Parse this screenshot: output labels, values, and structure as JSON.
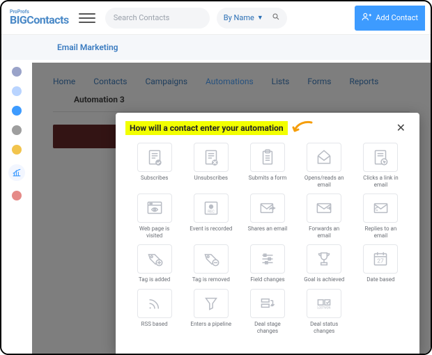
{
  "header": {
    "logo_top": "ProProfs",
    "logo_main": "BIGContacts",
    "search_placeholder": "Search Contacts",
    "filter_label": "By Name",
    "add_button": "Add Contact"
  },
  "subheader": {
    "title": "Email Marketing"
  },
  "tabs": [
    {
      "label": "Home"
    },
    {
      "label": "Contacts"
    },
    {
      "label": "Campaigns"
    },
    {
      "label": "Automations",
      "active": true
    },
    {
      "label": "Lists"
    },
    {
      "label": "Forms"
    },
    {
      "label": "Reports"
    }
  ],
  "automation": {
    "name": "Automation 3"
  },
  "modal": {
    "title": "How will a contact enter your automation",
    "triggers": [
      {
        "id": "subscribes",
        "label": "Subscribes",
        "icon": "doc-check"
      },
      {
        "id": "unsubscribes",
        "label": "Unsubscribes",
        "icon": "doc-x"
      },
      {
        "id": "submits-form",
        "label": "Submits a form",
        "icon": "clipboard"
      },
      {
        "id": "opens-email",
        "label": "Opens/reads an email",
        "icon": "envelope-open"
      },
      {
        "id": "clicks-link",
        "label": "Clicks a link in email",
        "icon": "doc-cursor"
      },
      {
        "id": "webpage-visited",
        "label": "Web page is visited",
        "icon": "browser-eye"
      },
      {
        "id": "event-recorded",
        "label": "Event is recorded",
        "icon": "rec"
      },
      {
        "id": "shares-email",
        "label": "Shares an email",
        "icon": "envelope-share"
      },
      {
        "id": "forwards-email",
        "label": "Forwards an email",
        "icon": "envelope-fwd"
      },
      {
        "id": "replies-email",
        "label": "Replies to an email",
        "icon": "envelope-reply"
      },
      {
        "id": "tag-added",
        "label": "Tag is added",
        "icon": "tag-plus"
      },
      {
        "id": "tag-removed",
        "label": "Tag is removed",
        "icon": "tag-minus"
      },
      {
        "id": "field-changes",
        "label": "Field changes",
        "icon": "sliders"
      },
      {
        "id": "goal-achieved",
        "label": "Goal is achieved",
        "icon": "trophy"
      },
      {
        "id": "date-based",
        "label": "Date based",
        "icon": "calendar"
      },
      {
        "id": "rss-based",
        "label": "RSS based",
        "icon": "rss"
      },
      {
        "id": "enters-pipeline",
        "label": "Enters a pipeline",
        "icon": "funnel"
      },
      {
        "id": "deal-stage",
        "label": "Deal stage changes",
        "icon": "stage"
      },
      {
        "id": "deal-status",
        "label": "Deal status changes",
        "icon": "status"
      }
    ]
  },
  "calendar_day": "27"
}
